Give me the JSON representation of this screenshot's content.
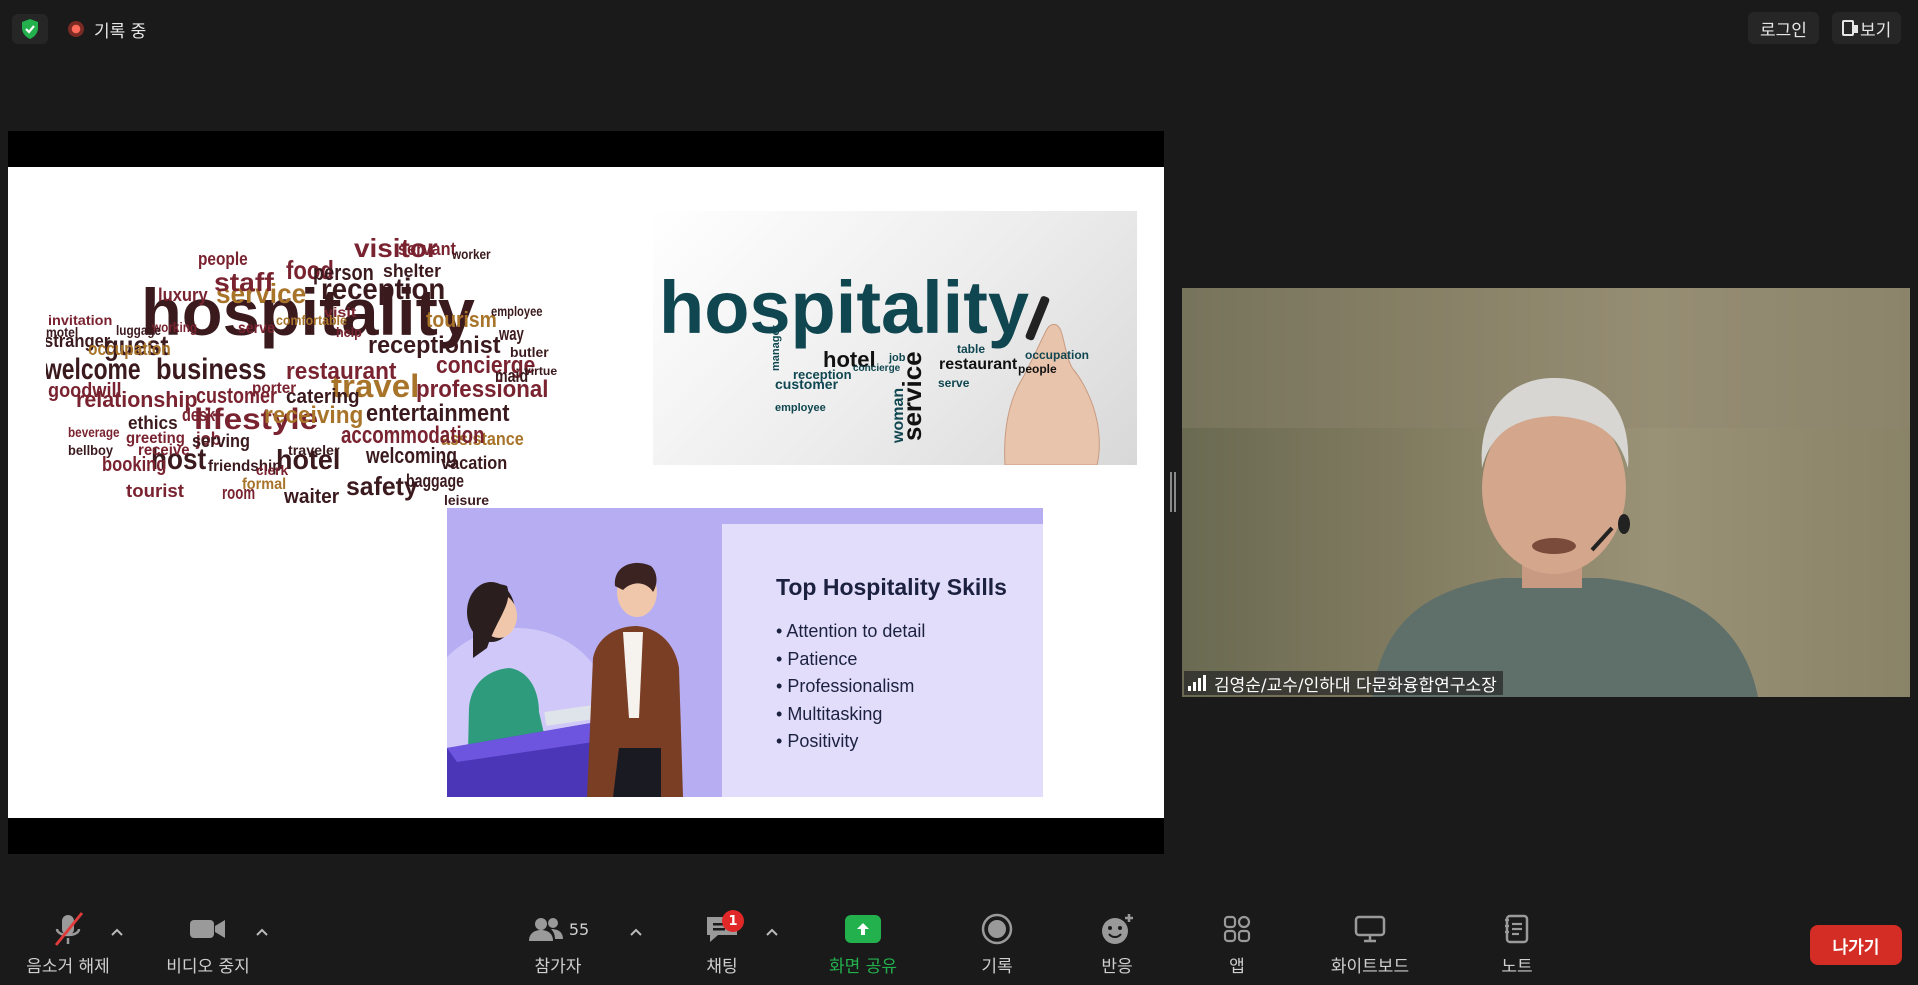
{
  "topbar": {
    "recording_label": "기록 중",
    "login_label": "로그인",
    "view_label": "보기",
    "icons": [
      "shield-check-icon",
      "recording-dot-icon",
      "view-layout-icon"
    ]
  },
  "slide": {
    "word_cloud": [
      "hospitality",
      "welcome",
      "business",
      "guest",
      "service",
      "reception",
      "host",
      "hotel",
      "travel",
      "lifestyle",
      "professional",
      "concierge",
      "restaurant",
      "receptionist",
      "customer",
      "relationship",
      "entertainment",
      "tourism",
      "assistance",
      "accommodation",
      "welcoming",
      "vacation",
      "baggage",
      "safety",
      "waiter",
      "room",
      "tourist",
      "booking",
      "ethics",
      "receiving",
      "friendship",
      "visitor",
      "servant",
      "food",
      "people",
      "staff",
      "luxury",
      "person",
      "shelter",
      "worker",
      "stranger",
      "occupation",
      "goodwill",
      "employee",
      "way",
      "butler",
      "virtue",
      "maid",
      "catering",
      "desk",
      "job",
      "leisure",
      "arrive",
      "formal",
      "clerk",
      "traveler",
      "porter",
      "visit",
      "comfortable",
      "help",
      "serve",
      "working",
      "luggage",
      "invitation",
      "motel",
      "beverage",
      "greeting",
      "serving",
      "receive",
      "bellboy"
    ],
    "image_wordmark": "hospitality",
    "image_words": [
      "hotel",
      "service",
      "restaurant",
      "customer",
      "reception",
      "serve",
      "occupation",
      "table",
      "people",
      "woman",
      "job",
      "manager",
      "employee",
      "concierge"
    ],
    "skills_title": "Top Hospitality Skills",
    "skills": [
      "Attention to detail",
      "Patience",
      "Professionalism",
      "Multitasking",
      "Positivity"
    ]
  },
  "participant": {
    "name": "김영순/교수/인하대 다문화융합연구소장"
  },
  "toolbar": {
    "unmute_label": "음소거 해제",
    "stop_video_label": "비디오 중지",
    "participants_label": "참가자",
    "participants_count": "55",
    "chat_label": "채팅",
    "chat_badge": "1",
    "share_screen_label": "화면 공유",
    "record_label": "기록",
    "reactions_label": "반응",
    "apps_label": "앱",
    "whiteboard_label": "화이트보드",
    "notes_label": "노트",
    "leave_label": "나가기"
  },
  "colors": {
    "background": "#1a1a1a",
    "share_green": "#23b14d",
    "leave_red": "#d42d25",
    "badge_red": "#e02828",
    "mute_red": "#e23b3b",
    "cloud_dark": "#3b1a1e",
    "cloud_maroon": "#7a2330",
    "cloud_gold": "#a8742a",
    "teal": "#0f4650"
  }
}
